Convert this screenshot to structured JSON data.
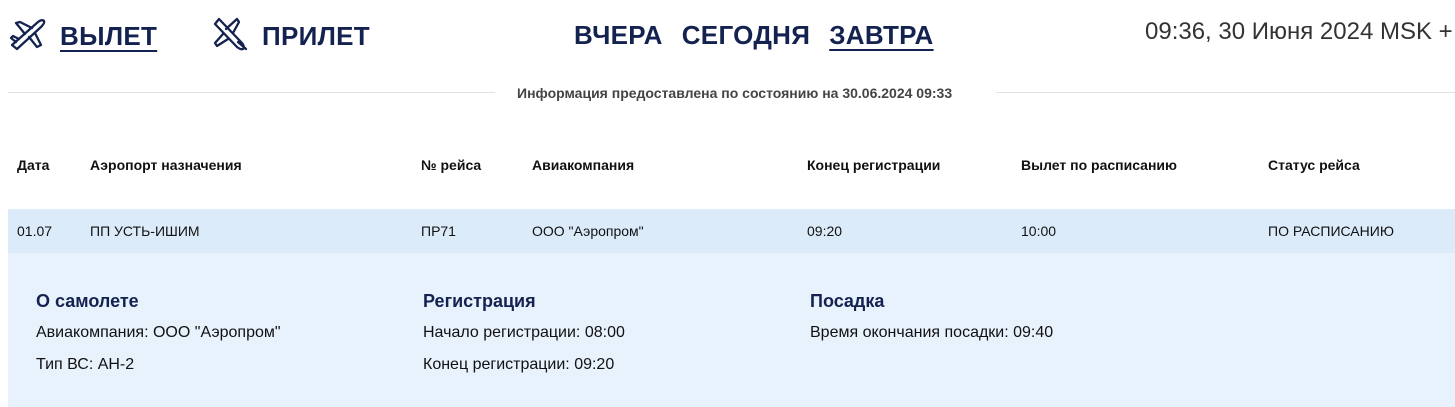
{
  "nav": {
    "departure_label": "ВЫЛЕТ",
    "arrival_label": "ПРИЛЕТ",
    "departure_icon": "plane-takeoff-icon",
    "arrival_icon": "plane-landing-icon",
    "active_direction": "departure"
  },
  "days": {
    "yesterday": "ВЧЕРА",
    "today": "СЕГОДНЯ",
    "tomorrow": "ЗАВТРА",
    "active": "tomorrow"
  },
  "clock": "09:36, 30 Июня 2024 MSK +",
  "info_text": "Информация предоставлена по состоянию на 30.06.2024 09:33",
  "table": {
    "headers": {
      "date": "Дата",
      "destination": "Аэропорт назначения",
      "flight": "№ рейса",
      "airline": "Авиакомпания",
      "checkin_end": "Конец регистрации",
      "scheduled": "Вылет по расписанию",
      "status": "Статус рейса"
    },
    "rows": [
      {
        "date": "01.07",
        "destination": "ПП УСТЬ-ИШИМ",
        "flight": "ПР71",
        "airline": "ООО \"Аэропром\"",
        "checkin_end": "09:20",
        "scheduled": "10:00",
        "status": "ПО РАСПИСАНИЮ"
      }
    ]
  },
  "details": {
    "aircraft": {
      "title": "О самолете",
      "airline": "Авиакомпания: ООО \"Аэропром\"",
      "type": "Тип ВС: АН-2"
    },
    "registration": {
      "title": "Регистрация",
      "start": "Начало регистрации: 08:00",
      "end": "Конец регистрации: 09:20"
    },
    "boarding": {
      "title": "Посадка",
      "end": "Время окончания посадки: 09:40"
    }
  },
  "colors": {
    "brand_navy": "#142250",
    "row_highlight": "#dcebfa",
    "details_bg": "#e8f2fd"
  }
}
